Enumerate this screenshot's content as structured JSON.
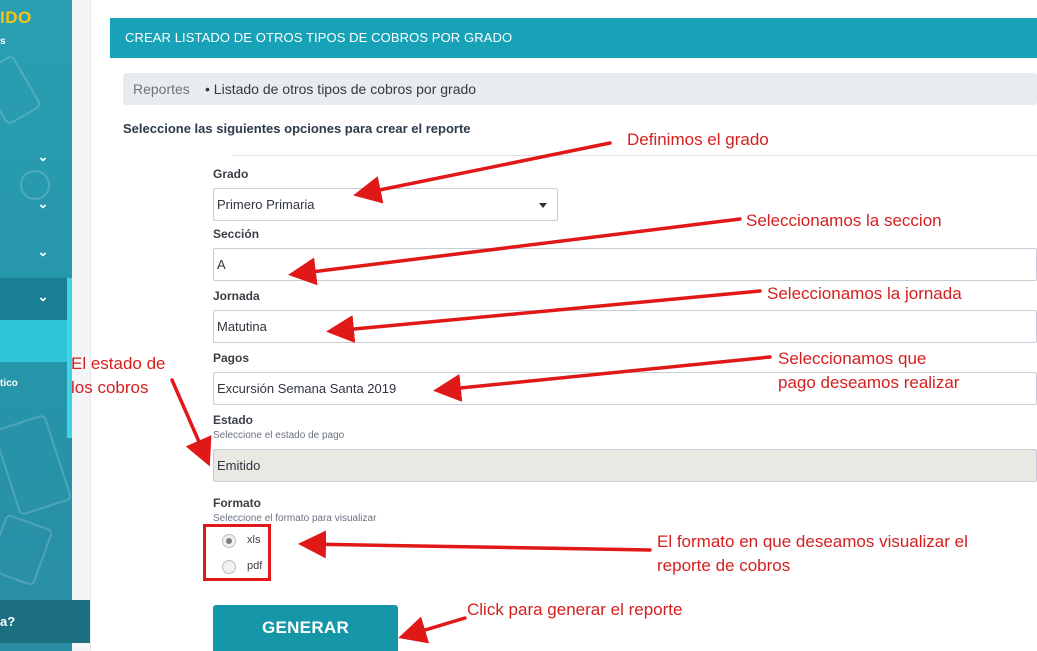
{
  "sidebar": {
    "brand": "IDO",
    "brand_sub": "s",
    "sub_label": "tico"
  },
  "chat": {
    "question": "a?",
    "icon": "chat-bubble-icon"
  },
  "card": {
    "title": "CREAR LISTADO DE OTROS TIPOS DE COBROS POR GRADO"
  },
  "breadcrumb": {
    "root": "Reportes",
    "current": "• Listado de otros tipos de cobros por grado"
  },
  "instruction": "Seleccione las siguientes opciones para crear el reporte",
  "form": {
    "grado": {
      "label": "Grado",
      "value": "Primero Primaria"
    },
    "seccion": {
      "label": "Sección",
      "value": "A"
    },
    "jornada": {
      "label": "Jornada",
      "value": "Matutina"
    },
    "pagos": {
      "label": "Pagos",
      "value": "Excursión Semana Santa 2019"
    },
    "estado": {
      "label": "Estado",
      "help": "Seleccione el estado de pago",
      "value": "Emitido"
    },
    "formato": {
      "label": "Formato",
      "help": "Seleccione el formato para visualizar",
      "options": [
        {
          "label": "xls",
          "checked": true
        },
        {
          "label": "pdf",
          "checked": false
        }
      ]
    },
    "submit_label": "GENERAR"
  },
  "annotations": {
    "grado": "Definimos el grado",
    "seccion": "Seleccionamos la seccion",
    "jornada": "Seleccionamos la jornada",
    "pagos_line1": "Seleccionamos que",
    "pagos_line2": "pago deseamos realizar",
    "estado_line1": "El estado de",
    "estado_line2": "los cobros",
    "formato_line1": "El formato en que deseamos visualizar el",
    "formato_line2": "reporte de cobros",
    "generar": "Click para generar el reporte"
  },
  "colors": {
    "accent": "#17a2b8",
    "annotation": "#d42020"
  }
}
